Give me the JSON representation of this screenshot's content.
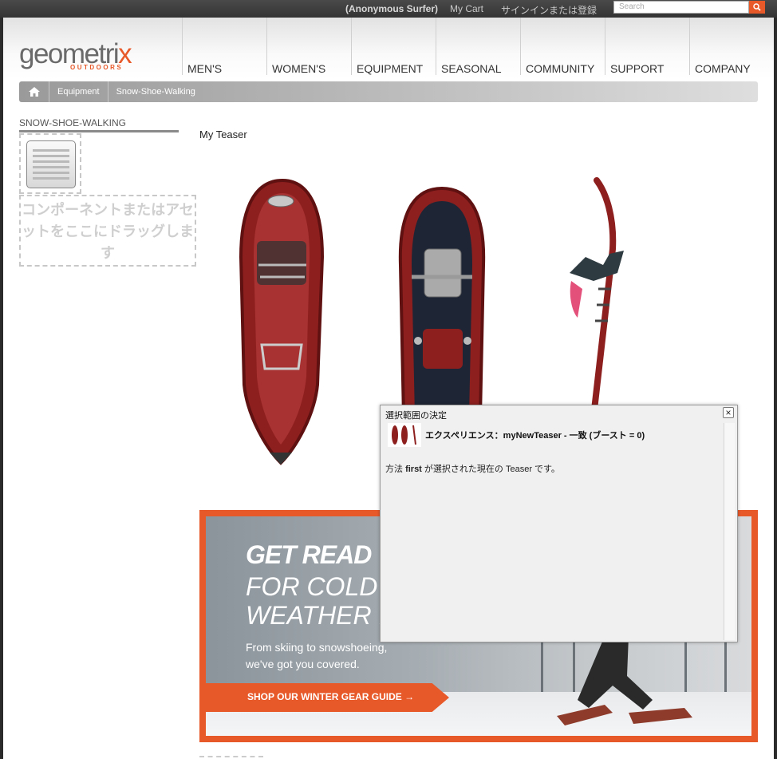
{
  "topbar": {
    "user": "(Anonymous Surfer)",
    "cart": "My Cart",
    "signin": "サインインまたは登録",
    "search_placeholder": "Search"
  },
  "logo": {
    "word_start": "geometri",
    "word_x": "x",
    "sub": "OUTDOORS"
  },
  "nav": [
    "MEN'S",
    "WOMEN'S",
    "EQUIPMENT",
    "SEASONAL",
    "COMMUNITY",
    "SUPPORT",
    "COMPANY"
  ],
  "breadcrumb": [
    "Equipment",
    "Snow-Shoe-Walking"
  ],
  "sidebar": {
    "title": "SNOW-SHOE-WALKING",
    "dropzone": "コンポーネントまたはアセットをここにドラッグします"
  },
  "teaser": {
    "title": "My Teaser"
  },
  "banner": {
    "line1": "GET READ",
    "line2": "FOR COLD",
    "line3": "WEATHER I",
    "body": "From skiing to snowshoeing, we've got you covered.",
    "cta": "SHOP OUR WINTER GEAR GUIDE →"
  },
  "dialog": {
    "title": "選択範囲の決定",
    "experience": "エクスペリエンス：myNewTeaser - 一致 (ブースト = 0)",
    "msg_prefix": "方法",
    "msg_method": "first",
    "msg_suffix": "が選択された現在の Teaser です。",
    "close": "×"
  },
  "colors": {
    "accent": "#e8592a",
    "product_red": "#8e1f1f"
  }
}
